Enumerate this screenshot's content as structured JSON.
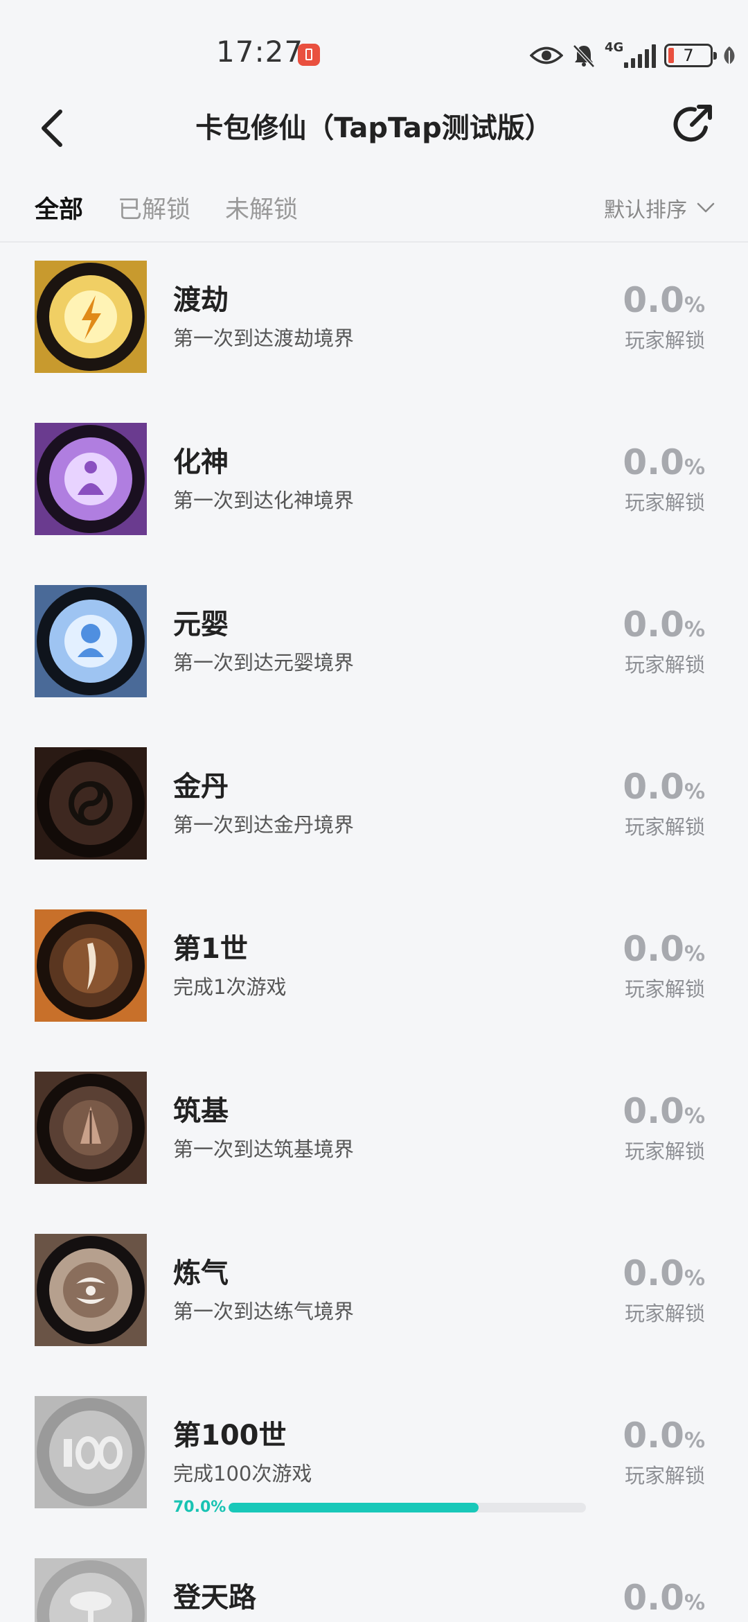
{
  "status": {
    "time": "17:27",
    "network": "4G",
    "battery": "7"
  },
  "header": {
    "title": "卡包修仙（TapTap测试版）"
  },
  "tabs": [
    {
      "label": "全部",
      "active": true
    },
    {
      "label": "已解锁",
      "active": false
    },
    {
      "label": "未解锁",
      "active": false
    }
  ],
  "sort": {
    "label": "默认排序"
  },
  "unlock_label": "玩家解锁",
  "achievements": [
    {
      "name": "渡劫",
      "desc": "第一次到达渡劫境界",
      "pct": "0.0",
      "unit": "%",
      "icon": "lightning-badge-icon",
      "color": "#e9b53a"
    },
    {
      "name": "化神",
      "desc": "第一次到达化神境界",
      "pct": "0.0",
      "unit": "%",
      "icon": "meditating-figure-badge-icon",
      "color": "#9b5fcf"
    },
    {
      "name": "元婴",
      "desc": "第一次到达元婴境界",
      "pct": "0.0",
      "unit": "%",
      "icon": "infant-figure-badge-icon",
      "color": "#5b8fd8"
    },
    {
      "name": "金丹",
      "desc": "第一次到达金丹境界",
      "pct": "0.0",
      "unit": "%",
      "icon": "yin-yang-badge-icon",
      "color": "#6b4a38"
    },
    {
      "name": "第1世",
      "desc": "完成1次游戏",
      "pct": "0.0",
      "unit": "%",
      "icon": "feather-badge-icon",
      "color": "#d9853a"
    },
    {
      "name": "筑基",
      "desc": "第一次到达筑基境界",
      "pct": "0.0",
      "unit": "%",
      "icon": "praying-hands-badge-icon",
      "color": "#8a6a58"
    },
    {
      "name": "炼气",
      "desc": "第一次到达练气境界",
      "pct": "0.0",
      "unit": "%",
      "icon": "swirl-hands-badge-icon",
      "color": "#b0967e"
    },
    {
      "name": "第100世",
      "desc": "完成100次游戏",
      "pct": "0.0",
      "unit": "%",
      "icon": "number-100-badge-icon",
      "color": "#aaaaaa",
      "locked": true,
      "progress_text": "70.0%",
      "progress": 0.7
    },
    {
      "name": "登天路",
      "desc": "",
      "pct": "0.0",
      "unit": "%",
      "icon": "tree-badge-icon",
      "color": "#bbbbbb",
      "locked": true
    }
  ]
}
